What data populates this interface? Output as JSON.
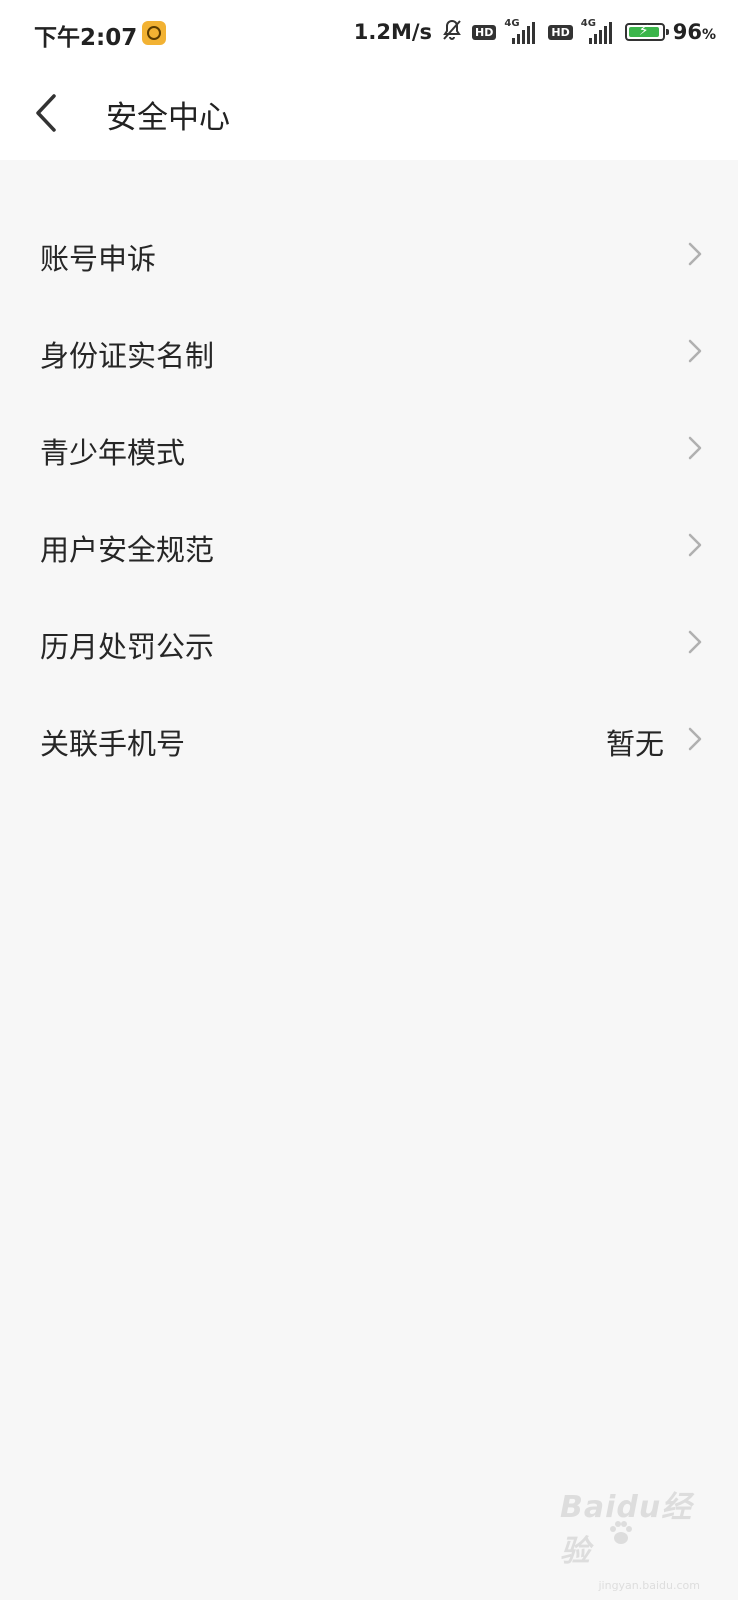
{
  "status_bar": {
    "time": "下午2:07",
    "app_icon": "game-notification-icon",
    "network_speed": "1.2M/s",
    "mute_icon": "bell-off-icon",
    "sim1": {
      "hd": "HD",
      "network": "4G"
    },
    "sim2": {
      "hd": "HD",
      "network": "4G"
    },
    "battery_level": 96,
    "battery_text": "96",
    "battery_unit": "%",
    "battery_color": "#3bb54a"
  },
  "header": {
    "back_icon": "chevron-left-icon",
    "title": "安全中心"
  },
  "menu": {
    "items": [
      {
        "label": "账号申诉",
        "value": ""
      },
      {
        "label": "身份证实名制",
        "value": ""
      },
      {
        "label": "青少年模式",
        "value": ""
      },
      {
        "label": "用户安全规范",
        "value": ""
      },
      {
        "label": "历月处罚公示",
        "value": ""
      },
      {
        "label": "关联手机号",
        "value": "暂无"
      }
    ],
    "chevron_icon": "chevron-right-icon"
  },
  "watermark": {
    "text": "Baidu经验",
    "sub": "jingyan.baidu.com"
  },
  "colors": {
    "background": "#f7f7f7",
    "header_bg": "#ffffff",
    "text": "#262626",
    "chevron": "#b0b0b0"
  }
}
